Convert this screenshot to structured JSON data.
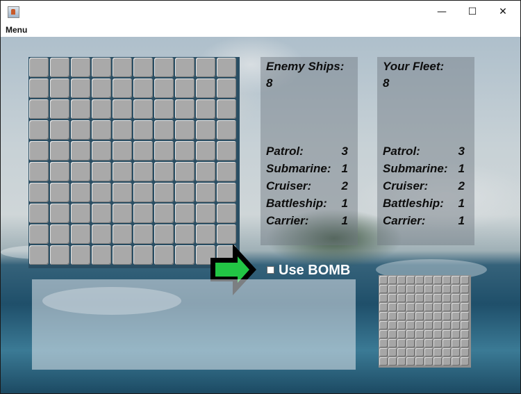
{
  "window": {
    "controls": {
      "minimize": "—",
      "maximize": "☐",
      "close": "✕"
    }
  },
  "menubar": {
    "menu_label": "Menu"
  },
  "enemy_panel": {
    "title": "Enemy Ships:",
    "count": "8",
    "ships": [
      {
        "name": "Patrol:",
        "count": "3"
      },
      {
        "name": "Submarine:",
        "count": "1"
      },
      {
        "name": "Cruiser:",
        "count": "2"
      },
      {
        "name": "Battleship:",
        "count": "1"
      },
      {
        "name": "Carrier:",
        "count": "1"
      }
    ]
  },
  "fleet_panel": {
    "title": "Your Fleet:",
    "count": "8",
    "ships": [
      {
        "name": "Patrol:",
        "count": "3"
      },
      {
        "name": "Submarine:",
        "count": "1"
      },
      {
        "name": "Cruiser:",
        "count": "2"
      },
      {
        "name": "Battleship:",
        "count": "1"
      },
      {
        "name": "Carrier:",
        "count": "1"
      }
    ]
  },
  "bomb_toggle": {
    "label": "Use BOMB",
    "checked": false
  },
  "grids": {
    "enemy_grid": {
      "rows": 10,
      "cols": 10
    },
    "own_grid": {
      "rows": 10,
      "cols": 10
    }
  },
  "colors": {
    "arrow_fill": "#22c545",
    "arrow_outline": "#000000",
    "cell": "#a9a9a9"
  }
}
